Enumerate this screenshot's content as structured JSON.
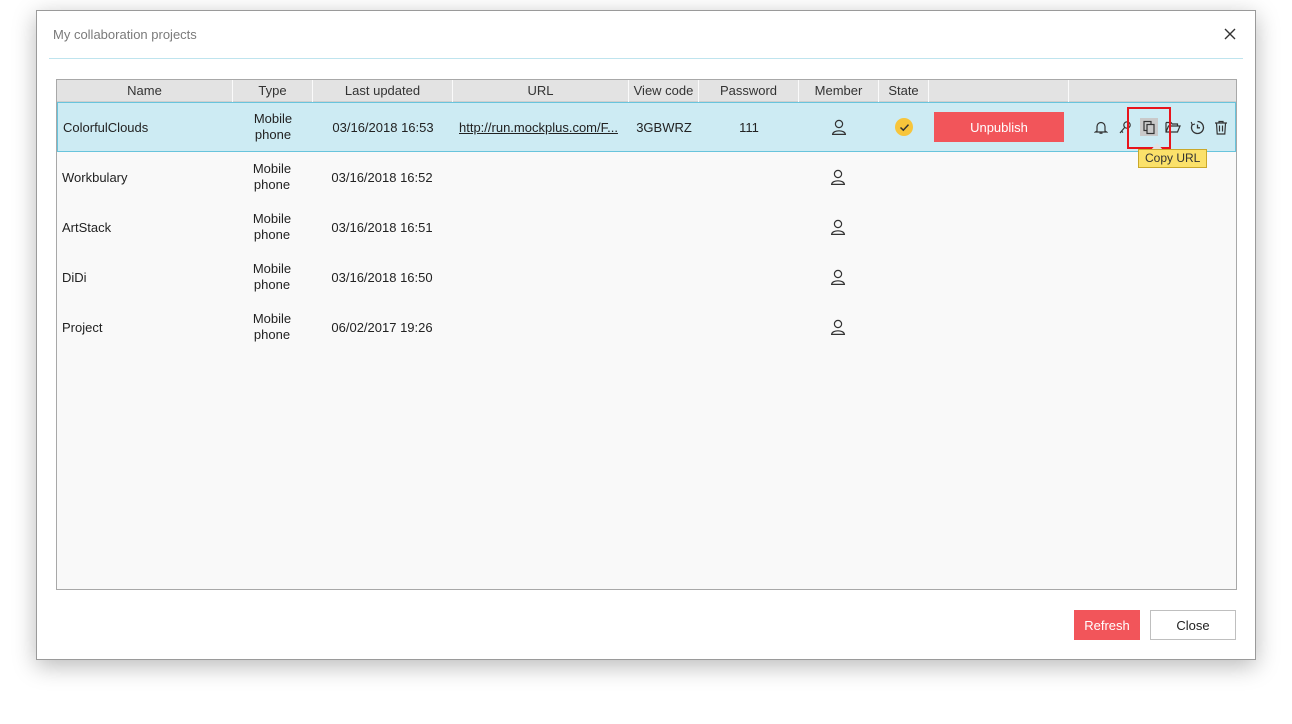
{
  "dialog": {
    "title": "My collaboration projects"
  },
  "columns": [
    "Name",
    "Type",
    "Last updated",
    "URL",
    "View code",
    "Password",
    "Member",
    "State",
    "",
    ""
  ],
  "rows": [
    {
      "name": "ColorfulClouds",
      "type_line1": "Mobile",
      "type_line2": "phone",
      "last_updated": "03/16/2018 16:53",
      "url": "http://run.mockplus.com/F...",
      "view_code": "3GBWRZ",
      "password": "111",
      "state": "published",
      "action_label": "Unpublish"
    },
    {
      "name": "Workbulary",
      "type_line1": "Mobile",
      "type_line2": "phone",
      "last_updated": "03/16/2018 16:52"
    },
    {
      "name": "ArtStack",
      "type_line1": "Mobile",
      "type_line2": "phone",
      "last_updated": "03/16/2018 16:51"
    },
    {
      "name": "DiDi",
      "type_line1": "Mobile",
      "type_line2": "phone",
      "last_updated": "03/16/2018 16:50"
    },
    {
      "name": "Project",
      "type_line1": "Mobile",
      "type_line2": "phone",
      "last_updated": "06/02/2017 19:26"
    }
  ],
  "row_actions": [
    "bell-icon",
    "key-icon",
    "copy-icon",
    "folder-open-icon",
    "history-icon",
    "trash-icon"
  ],
  "tooltip": {
    "text": "Copy URL"
  },
  "footer": {
    "refresh_label": "Refresh",
    "close_label": "Close"
  },
  "colors": {
    "accent_red": "#f2555a",
    "selected_row": "#cdebf3",
    "state_check": "#f7c53b",
    "tooltip_bg": "#fbe16a",
    "highlight_box": "#e8141b"
  }
}
